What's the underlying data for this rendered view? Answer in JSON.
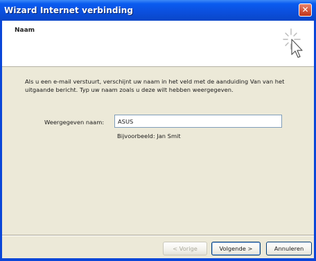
{
  "window": {
    "title": "Wizard Internet verbinding",
    "close_symbol": "✕"
  },
  "header": {
    "title": "Naam",
    "icon": "wizard-cursor-icon"
  },
  "content": {
    "intro": "Als u een e-mail verstuurt, verschijnt uw naam in het veld met de aanduiding Van van het uitgaande bericht. Typ uw naam zoals u deze wilt hebben weergegeven.",
    "field_label": "Weergegeven naam:",
    "field_value": "ASUS",
    "example": "Bijvoorbeeld: Jan Smit"
  },
  "buttons": {
    "back": "< Vorige",
    "next": "Volgende >",
    "cancel": "Annuleren"
  },
  "colors": {
    "titlebar": "#0b4fdc",
    "window_bg": "#ece9d8",
    "close_button": "#d5553b"
  }
}
